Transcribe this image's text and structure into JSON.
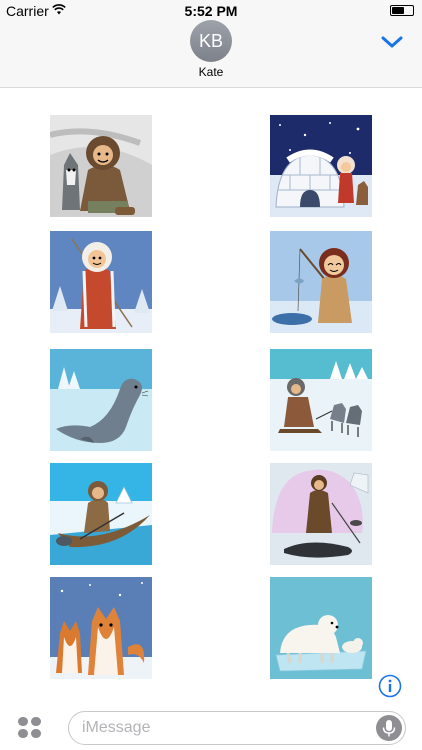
{
  "status_bar": {
    "carrier": "Carrier",
    "time": "5:52 PM",
    "battery_level": 0.5
  },
  "header": {
    "avatar_initials": "KB",
    "contact_name": "Kate",
    "collapse_icon": "chevron-down-icon",
    "accent_color": "#1a73e8"
  },
  "stickers": [
    {
      "name": "eskimo-boy-with-husky"
    },
    {
      "name": "igloo-with-child-and-dog"
    },
    {
      "name": "eskimo-girl-with-spear"
    },
    {
      "name": "ice-fishing-girl"
    },
    {
      "name": "seal-on-ice"
    },
    {
      "name": "dog-sled"
    },
    {
      "name": "hunter-in-kayak"
    },
    {
      "name": "hunter-with-seal"
    },
    {
      "name": "two-husky-dogs"
    },
    {
      "name": "polar-bear-on-ice-floe"
    }
  ],
  "compose": {
    "placeholder": "iMessage",
    "apps_icon": "app-drawer-icon",
    "info_icon": "info-icon",
    "mic_icon": "microphone-icon"
  }
}
